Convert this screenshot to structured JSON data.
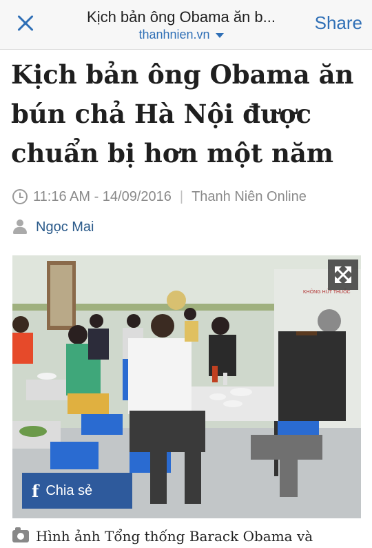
{
  "topbar": {
    "title": "Kịch bản ông Obama ăn b...",
    "domain": "thanhnien.vn",
    "share_label": "Share"
  },
  "article": {
    "headline": "Kịch bản ông Obama ăn bún chả Hà Nội được chuẩn bị hơn một năm",
    "time": "11:16 AM - 14/09/2016",
    "source": "Thanh Niên Online",
    "author": "Ngọc Mai"
  },
  "photo": {
    "wall_sign": "KHÔNG HÚT THUỐC",
    "share_chip_label": "Chia sẻ",
    "fb_glyph": "f"
  },
  "caption": {
    "text": "Hình ảnh Tổng thống Barack Obama và"
  },
  "colors": {
    "accent": "#2f6fb6",
    "share_chip": "#2e5a9c"
  },
  "icons": [
    "close-icon",
    "chevron-down-icon",
    "clock-icon",
    "person-icon",
    "expand-icon",
    "facebook-icon",
    "camera-icon"
  ]
}
